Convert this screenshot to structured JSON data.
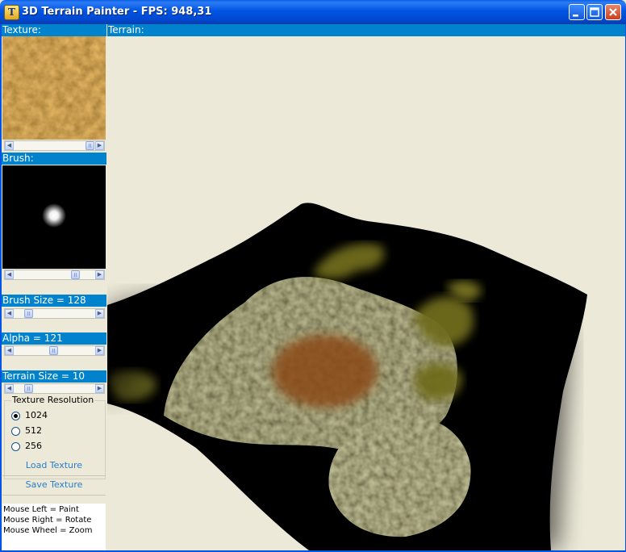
{
  "window": {
    "title": "3D Terrain Painter - FPS: 948,31",
    "app_icon_glyph": "T",
    "controls": [
      "minimize-icon",
      "maximize-icon",
      "close-icon"
    ]
  },
  "sidebar": {
    "texture_label": "Texture:",
    "brush_label": "Brush:",
    "brush_size_label": "Brush Size = 128",
    "alpha_label": "Alpha = 121",
    "terrain_size_label": "Terrain Size = 10",
    "texture_resolution": {
      "title": "Texture Resolution",
      "options": [
        "1024",
        "512",
        "256"
      ],
      "selected": "1024"
    },
    "load_texture_label": "Load Texture",
    "save_texture_label": "Save Texture",
    "help_lines": [
      "Mouse Left = Paint",
      "Mouse Right = Rotate",
      "Mouse Wheel = Zoom"
    ]
  },
  "terrain": {
    "label": "Terrain:"
  },
  "colors": {
    "header_bg": "#0083CC",
    "titlebar": "#0054E3",
    "link": "#2A7EC6",
    "background": "#ECE9D8"
  }
}
